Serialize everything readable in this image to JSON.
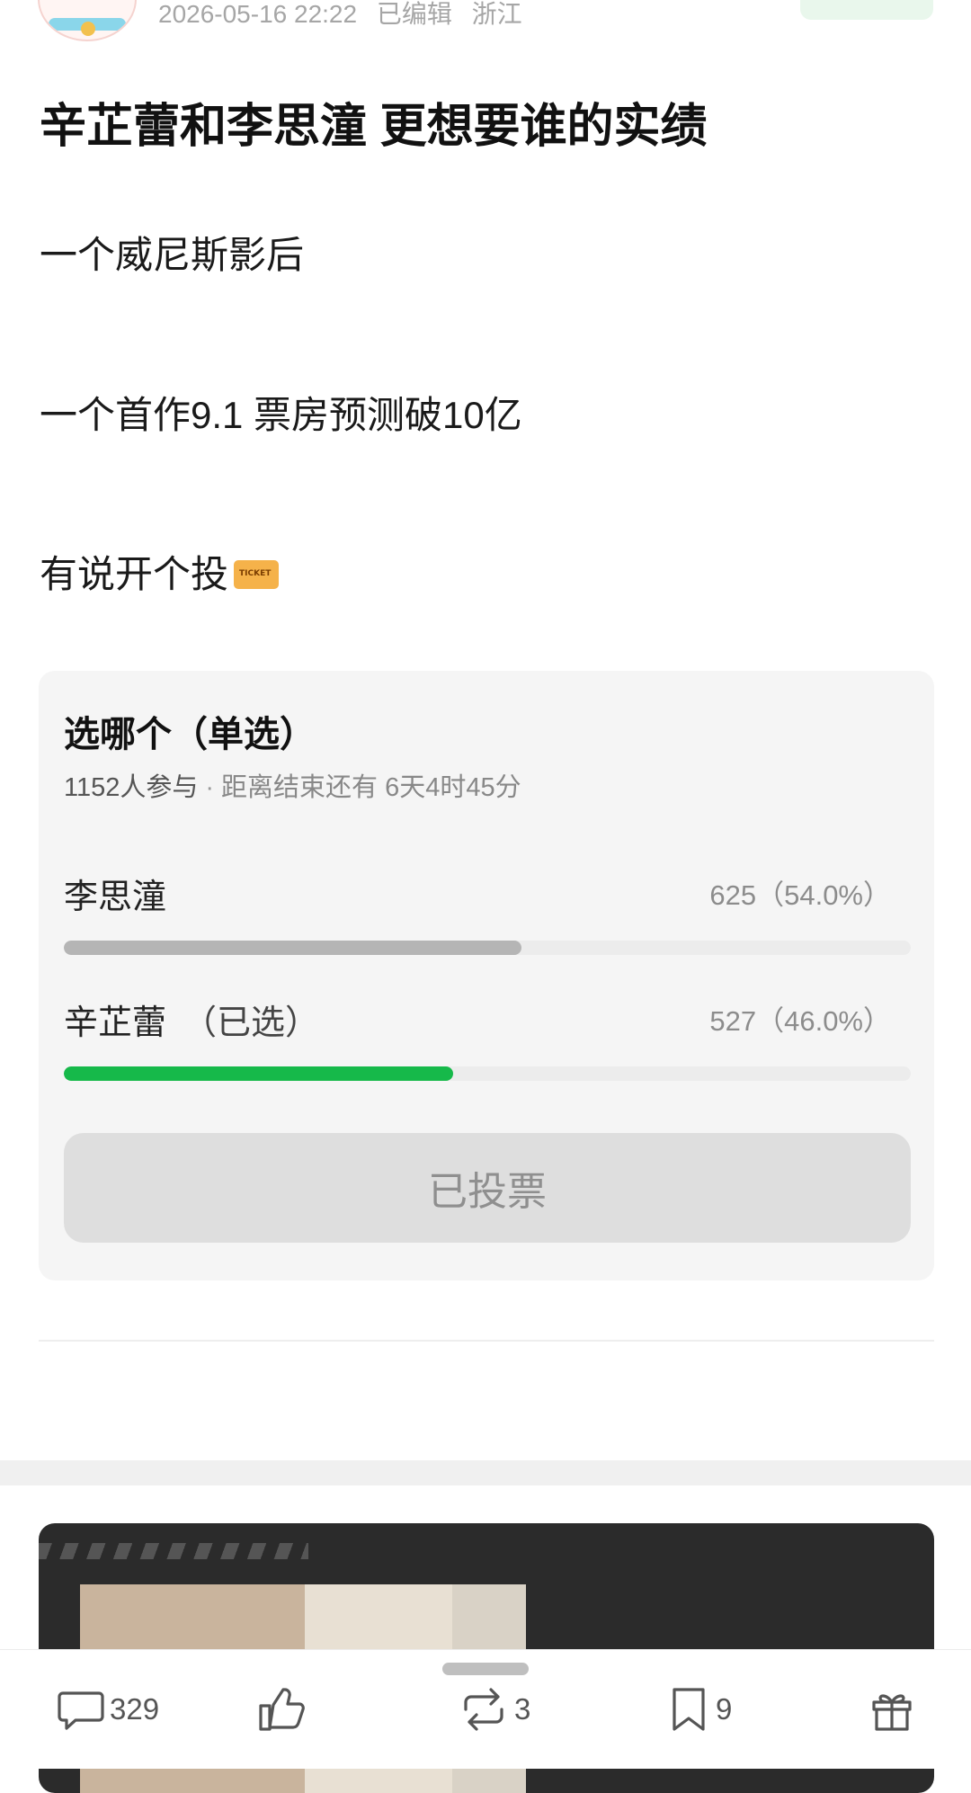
{
  "post": {
    "meta": {
      "datetime": "2026-05-16 22:22",
      "edited": "已编辑",
      "location": "浙江"
    },
    "title": "辛芷蕾和李思潼 更想要谁的实绩",
    "lines": [
      "一个威尼斯影后",
      "一个首作9.1 票房预测破10亿",
      "有说开个投"
    ],
    "ticket_emoji": "ticket-emoji"
  },
  "poll": {
    "title": "选哪个（单选）",
    "participants": "1152人参与",
    "separator": "·",
    "remaining": "距离结束还有 6天4时45分",
    "options": [
      {
        "name": "李思潼",
        "selected_label": "",
        "count": "625（54.0%）",
        "fraction": 0.54,
        "color": "#b5b5b5"
      },
      {
        "name": "辛芷蕾",
        "selected_label": "（已选）",
        "count": "527（46.0%）",
        "fraction": 0.46,
        "color": "#16b94a"
      }
    ],
    "button_label": "已投票"
  },
  "actions": {
    "comments": {
      "icon": "comment-icon",
      "count": "329"
    },
    "like": {
      "icon": "thumbs-up-icon"
    },
    "repost": {
      "icon": "repost-icon",
      "count": "3"
    },
    "favorite": {
      "icon": "bookmark-icon",
      "count": "9"
    },
    "gift": {
      "icon": "gift-icon"
    }
  },
  "colors": {
    "accent": "#16b94a",
    "muted": "#8c8c8c"
  }
}
